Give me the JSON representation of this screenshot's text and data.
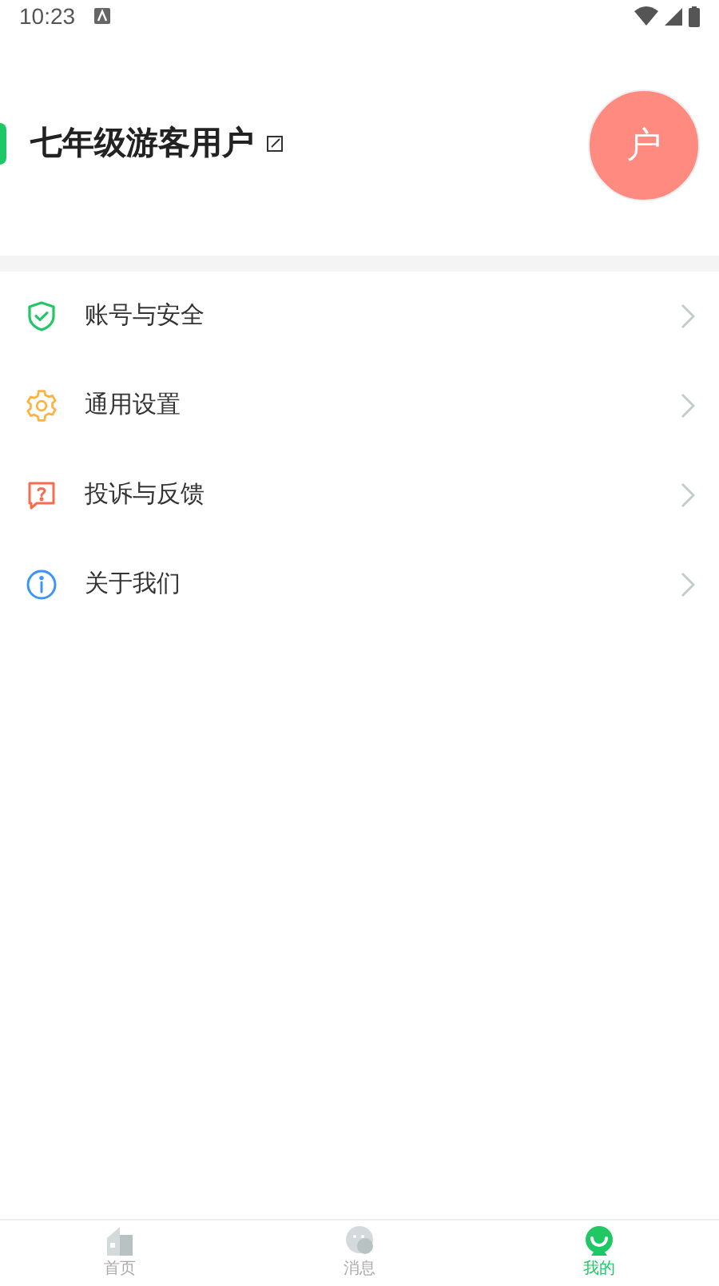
{
  "status_bar": {
    "time": "10:23"
  },
  "profile": {
    "name": "七年级游客用户",
    "avatar_text": "户"
  },
  "menu": [
    {
      "kind": "shield",
      "label": "账号与安全"
    },
    {
      "kind": "gear",
      "label": "通用设置"
    },
    {
      "kind": "feedback",
      "label": "投诉与反馈"
    },
    {
      "kind": "info",
      "label": "关于我们"
    }
  ],
  "tab_bar": [
    {
      "kind": "home",
      "label": "首页",
      "selected": false
    },
    {
      "kind": "message",
      "label": "消息",
      "selected": false
    },
    {
      "kind": "me",
      "label": "我的",
      "selected": true
    }
  ]
}
